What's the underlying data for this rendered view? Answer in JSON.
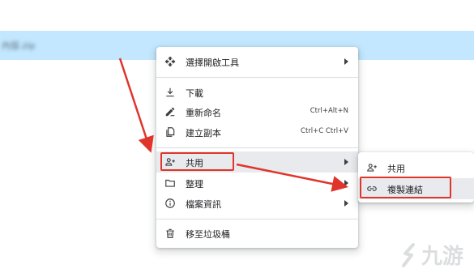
{
  "file_row": {
    "name": "內容.zip"
  },
  "main_menu": {
    "items": [
      {
        "label": "選擇開啟工具",
        "icon": "move-arrows-icon"
      },
      {
        "label": "下載",
        "icon": "download-icon"
      },
      {
        "label": "重新命名",
        "shortcut": "Ctrl+Alt+N",
        "icon": "pencil-icon"
      },
      {
        "label": "建立副本",
        "shortcut": "Ctrl+C Ctrl+V",
        "icon": "copy-icon"
      },
      {
        "label": "共用",
        "icon": "person-add-icon"
      },
      {
        "label": "整理",
        "icon": "folder-icon"
      },
      {
        "label": "檔案資訊",
        "icon": "info-icon"
      },
      {
        "label": "移至垃圾桶",
        "icon": "trash-icon"
      }
    ]
  },
  "sub_menu": {
    "items": [
      {
        "label": "共用",
        "icon": "person-add-icon"
      },
      {
        "label": "複製連結",
        "icon": "link-icon"
      }
    ]
  },
  "annotation_color": "#e0352b",
  "watermark": {
    "text": "九游"
  }
}
